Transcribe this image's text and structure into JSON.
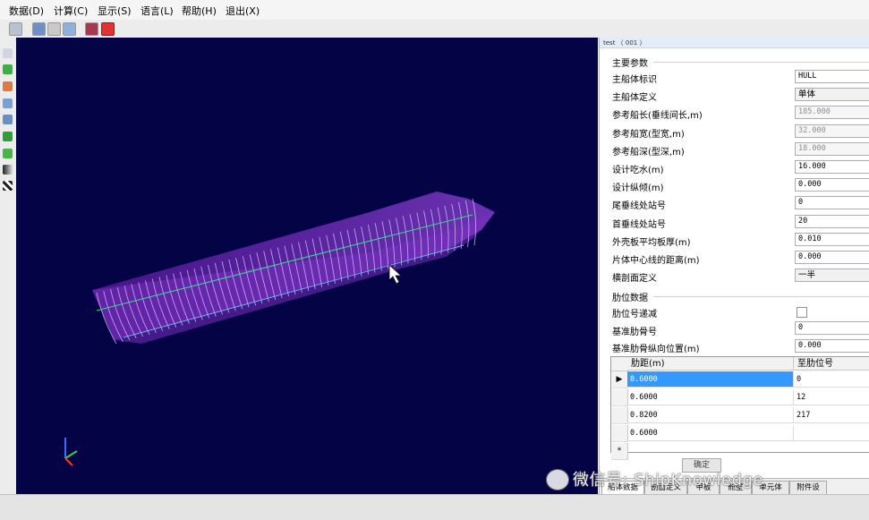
{
  "menu": [
    "数据(D)",
    "计算(C)",
    "显示(S)",
    "语言(L)",
    "帮助(H)",
    "退出(X)"
  ],
  "breadcrumb": "test 〈 001 〉",
  "main_params": {
    "title": "主要参数",
    "rows": [
      {
        "label": "主船体标识",
        "value": "HULL",
        "state": "normal"
      },
      {
        "label": "主船体定义",
        "value": "单体",
        "state": "combo"
      },
      {
        "label": "参考船长(垂线间长,m)",
        "value": "185.000",
        "state": "disabled"
      },
      {
        "label": "参考船宽(型宽,m)",
        "value": "32.000",
        "state": "disabled"
      },
      {
        "label": "参考船深(型深,m)",
        "value": "18.000",
        "state": "disabled"
      },
      {
        "label": "设计吃水(m)",
        "value": "16.000",
        "state": "normal"
      },
      {
        "label": "设计纵倾(m)",
        "value": "0.000",
        "state": "normal"
      },
      {
        "label": "尾垂线处站号",
        "value": "0",
        "state": "normal"
      },
      {
        "label": "首垂线处站号",
        "value": "20",
        "state": "normal"
      },
      {
        "label": "外壳板平均板厚(m)",
        "value": "0.010",
        "state": "normal"
      },
      {
        "label": "片体中心线的距离(m)",
        "value": "0.000",
        "state": "normal"
      },
      {
        "label": "横剖面定义",
        "value": "一半",
        "state": "combo"
      }
    ]
  },
  "rib_data": {
    "title": "肋位数据",
    "rows": [
      {
        "label": "肋位号递减",
        "type": "checkbox"
      },
      {
        "label": "基准肋骨号",
        "value": "0",
        "type": "field"
      },
      {
        "label": "基准肋骨纵向位置(m)",
        "value": "0.000",
        "type": "field"
      }
    ]
  },
  "grid": {
    "headers": [
      "肋距(m)",
      "至肋位号"
    ],
    "rows": [
      [
        "0.6000",
        "0"
      ],
      [
        "0.6000",
        "12"
      ],
      [
        "0.8200",
        "217"
      ],
      [
        "0.6000",
        ""
      ]
    ],
    "new_row_marker": "*",
    "current_row_marker": "▶"
  },
  "ok_button": "确定",
  "tabs": [
    "船体数据",
    "剖面定义",
    "甲板",
    "舱壁",
    "单元体",
    "附件设"
  ],
  "watermark": "微信号: ShipKnowledge",
  "colors": {
    "viewport_bg": "#030345",
    "hull": "#8a3fd1",
    "frames": "#c8b8ff",
    "selection": "#3399ff"
  }
}
